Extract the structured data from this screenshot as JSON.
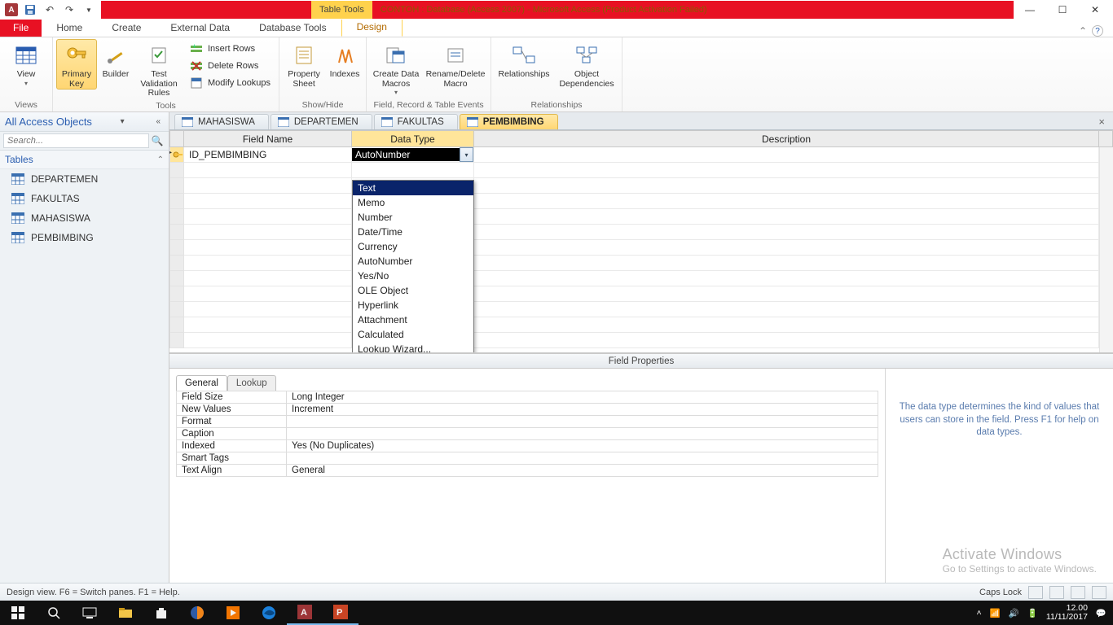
{
  "titlebar": {
    "table_tools": "Table Tools",
    "title": "CONTOH : Database (Access 2007)  -  Microsoft Access (Product Activation Failed)"
  },
  "menu": {
    "file": "File",
    "home": "Home",
    "create": "Create",
    "external": "External Data",
    "dbtools": "Database Tools",
    "design": "Design"
  },
  "ribbon": {
    "views": {
      "view": "View",
      "group": "Views"
    },
    "tools": {
      "primary_key": "Primary Key",
      "builder": "Builder",
      "test_rules": "Test Validation Rules",
      "insert_rows": "Insert Rows",
      "delete_rows": "Delete Rows",
      "modify_lookups": "Modify Lookups",
      "group": "Tools"
    },
    "showhide": {
      "property_sheet": "Property Sheet",
      "indexes": "Indexes",
      "group": "Show/Hide"
    },
    "events": {
      "create_macros": "Create Data Macros",
      "rename_delete": "Rename/Delete Macro",
      "group": "Field, Record & Table Events"
    },
    "relationships": {
      "relationships": "Relationships",
      "dependencies": "Object Dependencies",
      "group": "Relationships"
    }
  },
  "nav": {
    "header": "All Access Objects",
    "search_placeholder": "Search...",
    "tables_label": "Tables",
    "tables": [
      "DEPARTEMEN",
      "FAKULTAS",
      "MAHASISWA",
      "PEMBIMBING"
    ]
  },
  "doctabs": [
    "MAHASISWA",
    "DEPARTEMEN",
    "FAKULTAS",
    "PEMBIMBING"
  ],
  "grid": {
    "col_field": "Field Name",
    "col_type": "Data Type",
    "col_desc": "Description",
    "row0_field": "ID_PEMBIMBING",
    "row0_type": "AutoNumber"
  },
  "datatype_options": [
    "Text",
    "Memo",
    "Number",
    "Date/Time",
    "Currency",
    "AutoNumber",
    "Yes/No",
    "OLE Object",
    "Hyperlink",
    "Attachment",
    "Calculated",
    "Lookup Wizard..."
  ],
  "fp": {
    "title": "Field Properties",
    "tab_general": "General",
    "tab_lookup": "Lookup",
    "rows": [
      {
        "k": "Field Size",
        "v": "Long Integer"
      },
      {
        "k": "New Values",
        "v": "Increment"
      },
      {
        "k": "Format",
        "v": ""
      },
      {
        "k": "Caption",
        "v": ""
      },
      {
        "k": "Indexed",
        "v": "Yes (No Duplicates)"
      },
      {
        "k": "Smart Tags",
        "v": ""
      },
      {
        "k": "Text Align",
        "v": "General"
      }
    ],
    "hint": "The data type determines the kind of values that users can store in the field. Press F1 for help on data types."
  },
  "watermark": {
    "l1": "Activate Windows",
    "l2": "Go to Settings to activate Windows."
  },
  "status": {
    "left": "Design view.   F6 = Switch panes.   F1 = Help.",
    "caps": "Caps Lock"
  },
  "taskbar": {
    "time": "12.00",
    "date": "11/11/2017"
  }
}
